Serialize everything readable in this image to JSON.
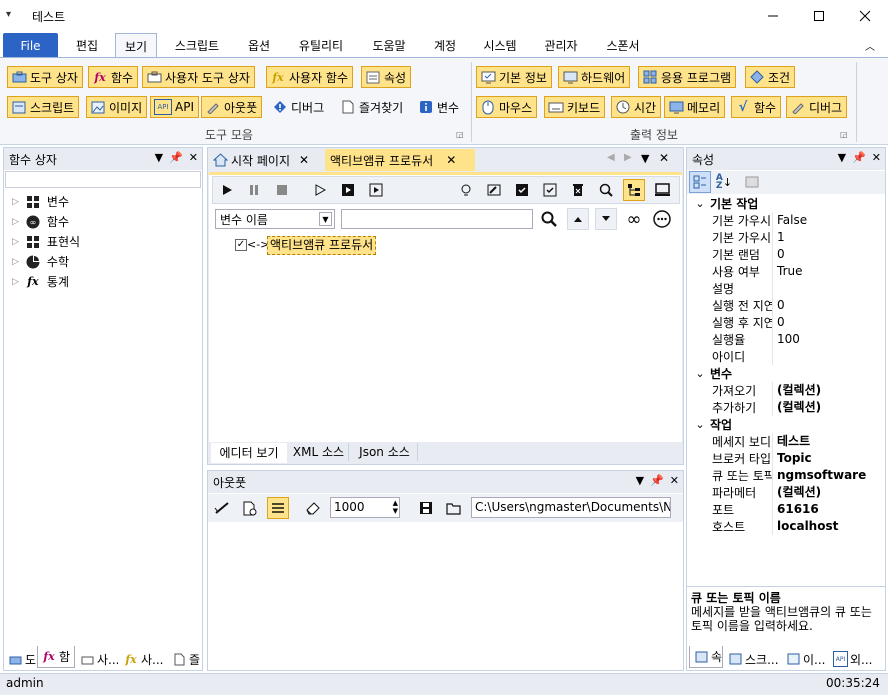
{
  "window": {
    "title": "테스트"
  },
  "menu": {
    "file": "File",
    "tabs": [
      "편집",
      "보기",
      "스크립트",
      "옵션",
      "유틸리티",
      "도움말",
      "계정",
      "시스템",
      "관리자",
      "스폰서"
    ]
  },
  "ribbon": {
    "group1": {
      "label": "도구 모음",
      "row1": [
        "도구 상자",
        "함수",
        "사용자 도구 상자",
        "사용자 함수",
        "속성"
      ],
      "row2": [
        "스크립트",
        "이미지",
        "API",
        "아웃풋",
        "디버그",
        "즐겨찾기",
        "변수"
      ]
    },
    "group2": {
      "label": "출력 정보",
      "row1": [
        "기본 정보",
        "하드웨어",
        "응용 프로그램",
        "조건"
      ],
      "row2": [
        "마우스",
        "키보드",
        "시간",
        "메모리",
        "함수",
        "디버그"
      ]
    }
  },
  "left_panel": {
    "title": "함수 상자",
    "tree": [
      "변수",
      "함수",
      "표현식",
      "수학",
      "통계"
    ],
    "bottom_tabs": [
      "도",
      "함",
      "사...",
      "사...",
      "즐"
    ]
  },
  "editor": {
    "tabs": [
      "시작 페이지",
      "액티브앰큐 프로듀서"
    ],
    "var_select": "변수 이름",
    "search_value": "",
    "node_label": "액티브앰큐 프로듀서",
    "node_prefix": "<->",
    "view_tabs": [
      "에디터 보기",
      "XML 소스",
      "Json 소스"
    ]
  },
  "output": {
    "title": "아웃풋",
    "count": "1000",
    "path": "C:\\Users\\ngmaster\\Documents\\NGM"
  },
  "properties": {
    "title": "속성",
    "categories": [
      {
        "name": "기본 작업",
        "rows": [
          {
            "name": "기본 가우시",
            "value": "False"
          },
          {
            "name": "기본 가우시",
            "value": "1"
          },
          {
            "name": "기본 랜덤",
            "value": "0"
          },
          {
            "name": "사용 여부",
            "value": "True"
          },
          {
            "name": "설명",
            "value": ""
          },
          {
            "name": "실행 전 지연",
            "value": "0"
          },
          {
            "name": "실행 후 지연",
            "value": "0"
          },
          {
            "name": "실행율",
            "value": "100"
          },
          {
            "name": "아이디",
            "value": ""
          }
        ]
      },
      {
        "name": "변수",
        "rows": [
          {
            "name": "가져오기",
            "value": "(컬렉션)"
          },
          {
            "name": "추가하기",
            "value": "(컬렉션)"
          }
        ]
      },
      {
        "name": "작업",
        "rows": [
          {
            "name": "메세지 보디",
            "value": "테스트"
          },
          {
            "name": "브로커 타입",
            "value": "Topic"
          },
          {
            "name": "큐 또는 토픽",
            "value": "ngmsoftware"
          },
          {
            "name": "파라메터",
            "value": "(컬렉션)"
          },
          {
            "name": "포트",
            "value": "61616"
          },
          {
            "name": "호스트",
            "value": "localhost"
          }
        ]
      }
    ],
    "desc_title": "큐 또는 토픽 이름",
    "desc_text": "메세지를 받을 액티브앰큐의 큐 또는 토픽 이름을 입력하세요.",
    "bottom_tabs": [
      "속",
      "스크...",
      "이...",
      "외..."
    ]
  },
  "status": {
    "user": "admin",
    "time": "00:35:24"
  },
  "colors": {
    "accent": "#2b64c5",
    "highlight": "#ffe38a",
    "highlight_border": "#e0a21b"
  }
}
